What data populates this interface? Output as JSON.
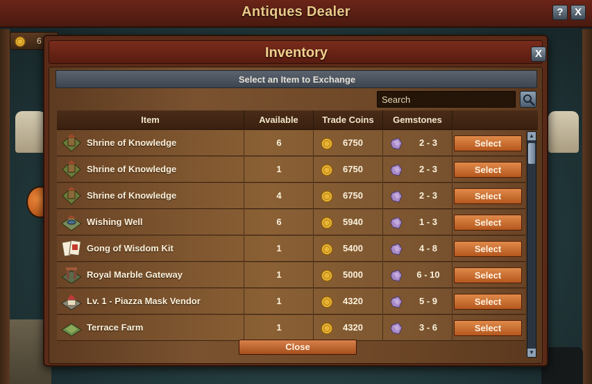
{
  "background": {
    "title": "Antiques Dealer",
    "help_label": "?",
    "close_label": "X",
    "coin_amount": "6"
  },
  "dialog": {
    "title": "Inventory",
    "close_label": "X",
    "subtitle": "Select an Item to Exchange",
    "search_placeholder": "Search",
    "close_button_label": "Close"
  },
  "table": {
    "headers": {
      "item": "Item",
      "available": "Available",
      "trade_coins": "Trade Coins",
      "gemstones": "Gemstones"
    },
    "rows": [
      {
        "name": "Shrine of Knowledge",
        "available": "6",
        "coins": "6750",
        "gems": "2 - 3",
        "button": "Select",
        "icon": "shrine-icon"
      },
      {
        "name": "Shrine of Knowledge",
        "available": "1",
        "coins": "6750",
        "gems": "2 - 3",
        "button": "Select",
        "icon": "shrine-icon"
      },
      {
        "name": "Shrine of Knowledge",
        "available": "4",
        "coins": "6750",
        "gems": "2 - 3",
        "button": "Select",
        "icon": "shrine-icon"
      },
      {
        "name": "Wishing Well",
        "available": "6",
        "coins": "5940",
        "gems": "1 - 3",
        "button": "Select",
        "icon": "wishing-well-icon"
      },
      {
        "name": "Gong of Wisdom Kit",
        "available": "1",
        "coins": "5400",
        "gems": "4 - 8",
        "button": "Select",
        "icon": "kit-cards-icon"
      },
      {
        "name": "Royal Marble Gateway",
        "available": "1",
        "coins": "5000",
        "gems": "6 - 10",
        "button": "Select",
        "icon": "gateway-icon"
      },
      {
        "name": "Lv. 1 - Piazza Mask Vendor",
        "available": "1",
        "coins": "4320",
        "gems": "5 - 9",
        "button": "Select",
        "icon": "mask-vendor-icon"
      },
      {
        "name": "Terrace Farm",
        "available": "1",
        "coins": "4320",
        "gems": "3 - 6",
        "button": "Select",
        "icon": "terrace-farm-icon"
      }
    ]
  },
  "colors": {
    "accent_orange": "#c46a2e",
    "header_red": "#6b2418",
    "title_gold": "#f2d08e",
    "wood": "#7a5230"
  }
}
